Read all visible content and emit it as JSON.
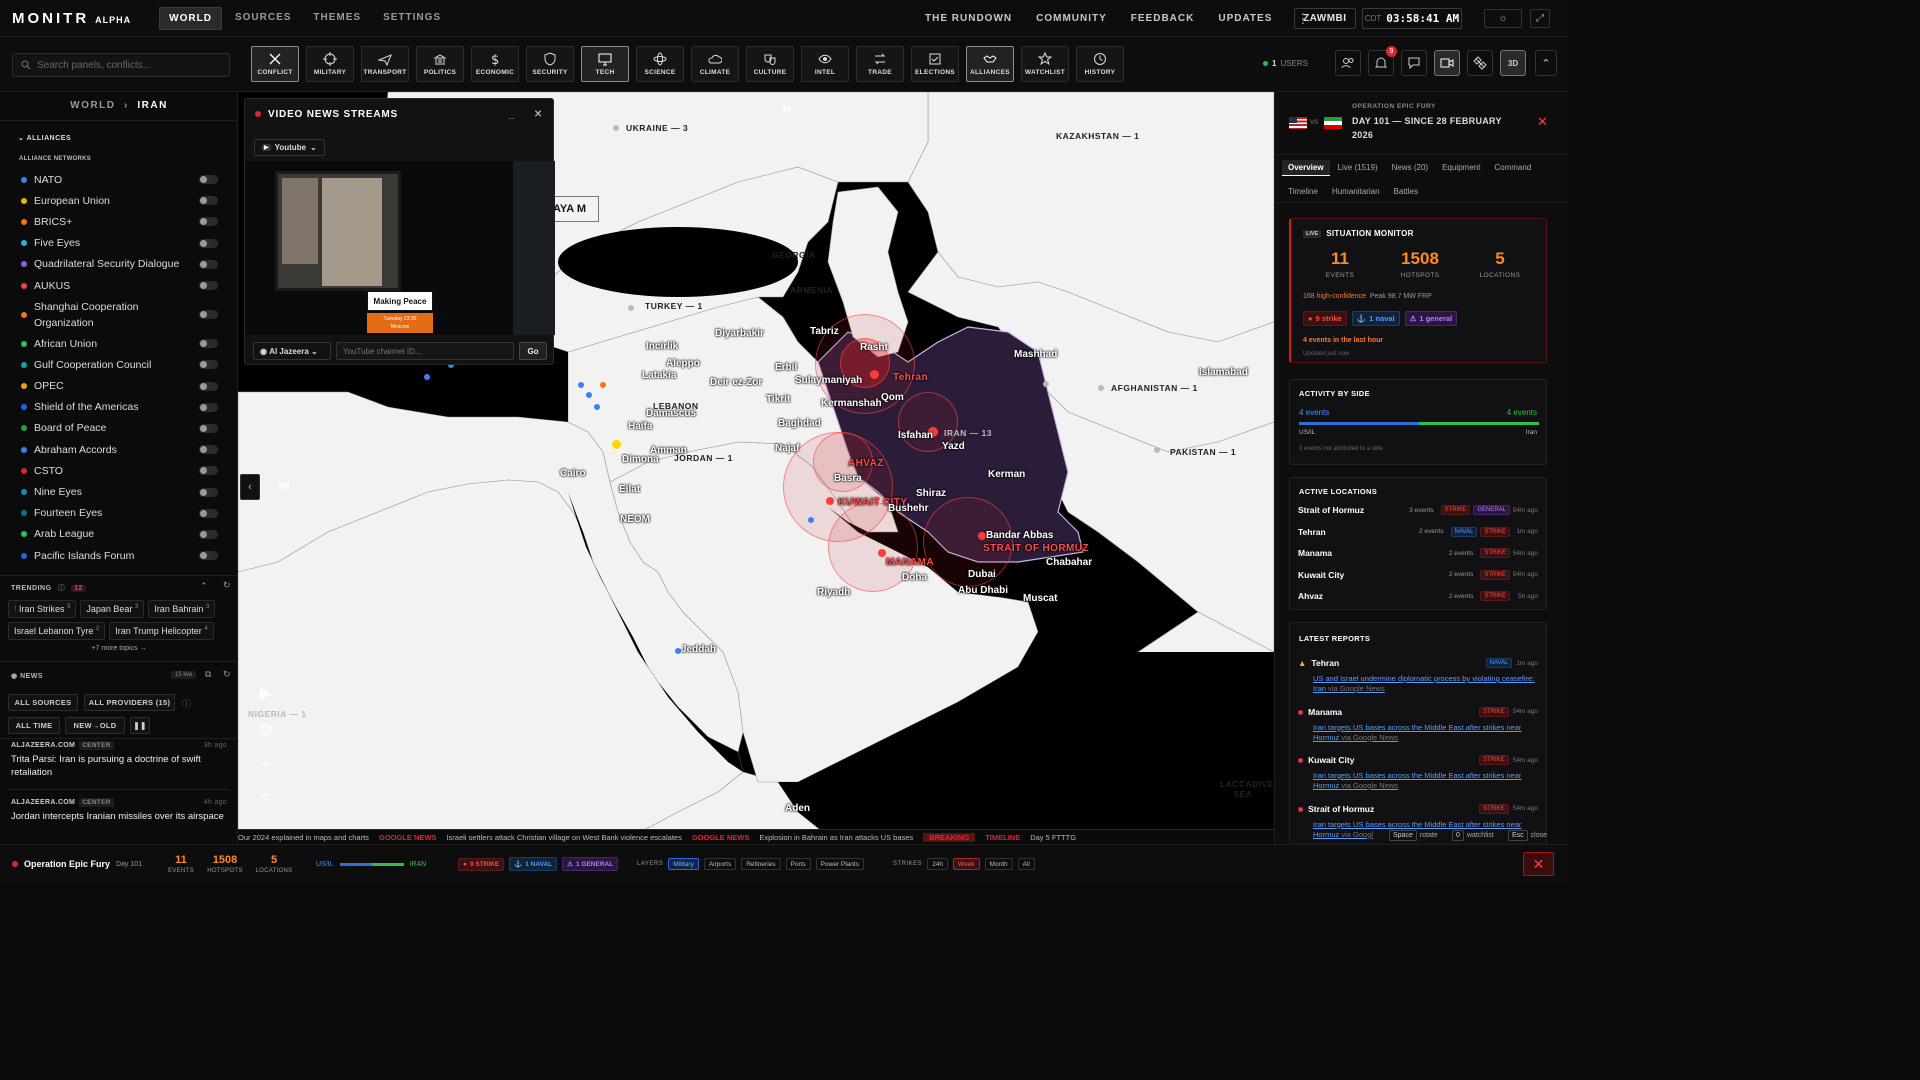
{
  "app": {
    "logo": "MONITR",
    "logo_sub": "ALPHA"
  },
  "nav": {
    "tabs": [
      "WORLD",
      "SOURCES",
      "THEMES",
      "SETTINGS"
    ]
  },
  "toplinks": [
    "THE RUNDOWN",
    "COMMUNITY",
    "FEEDBACK",
    "UPDATES"
  ],
  "user": "ZAWMBI",
  "clock": {
    "tz": "CDT",
    "time": "03:58:41 AM"
  },
  "search": {
    "placeholder": "Search panels, conflicts..."
  },
  "categories": [
    {
      "label": "CONFLICT",
      "icon": "conflict-icon",
      "active": true
    },
    {
      "label": "MILITARY",
      "icon": "crosshair-icon",
      "active": false
    },
    {
      "label": "TRANSPORT",
      "icon": "plane-icon",
      "active": false
    },
    {
      "label": "POLITICS",
      "icon": "capitol-icon",
      "active": false
    },
    {
      "label": "ECONOMIC",
      "icon": "dollar-icon",
      "active": false
    },
    {
      "label": "SECURITY",
      "icon": "shield-icon",
      "active": false
    },
    {
      "label": "TECH",
      "icon": "monitor-icon",
      "active": true
    },
    {
      "label": "SCIENCE",
      "icon": "atom-icon",
      "active": false
    },
    {
      "label": "CLIMATE",
      "icon": "cloud-icon",
      "active": false
    },
    {
      "label": "CULTURE",
      "icon": "masks-icon",
      "active": false
    },
    {
      "label": "INTEL",
      "icon": "eye-icon",
      "active": false
    },
    {
      "label": "TRADE",
      "icon": "exchange-icon",
      "active": false
    },
    {
      "label": "ELECTIONS",
      "icon": "ballot-icon",
      "active": false
    },
    {
      "label": "ALLIANCES",
      "icon": "handshake-icon",
      "active": true
    },
    {
      "label": "WATCHLIST",
      "icon": "star-icon",
      "active": false
    },
    {
      "label": "HISTORY",
      "icon": "clock-icon",
      "active": false
    }
  ],
  "users": {
    "count": "1",
    "label": "USERS"
  },
  "notifications": {
    "count": "9"
  },
  "view_3d": "3D",
  "breadcrumb": {
    "root": "WORLD",
    "current": "IRAN"
  },
  "alliances": {
    "title": "ALLIANCES",
    "subtitle": "ALLIANCE NETWORKS",
    "items": [
      {
        "name": "NATO",
        "color": "#3b82f6"
      },
      {
        "name": "European Union",
        "color": "#eab308"
      },
      {
        "name": "BRICS+",
        "color": "#f97316"
      },
      {
        "name": "Five Eyes",
        "color": "#22b8cf"
      },
      {
        "name": "Quadrilateral Security Dialogue",
        "color": "#8b5cf6"
      },
      {
        "name": "AUKUS",
        "color": "#ef4444"
      },
      {
        "name": "Shanghai Cooperation Organization",
        "color": "#f97316"
      },
      {
        "name": "African Union",
        "color": "#22c55e"
      },
      {
        "name": "Gulf Cooperation Council",
        "color": "#0ea5a4"
      },
      {
        "name": "OPEC",
        "color": "#f59e0b"
      },
      {
        "name": "Shield of the Americas",
        "color": "#2563eb"
      },
      {
        "name": "Board of Peace",
        "color": "#16a34a"
      },
      {
        "name": "Abraham Accords",
        "color": "#3b82f6"
      },
      {
        "name": "CSTO",
        "color": "#dc2626"
      },
      {
        "name": "Nine Eyes",
        "color": "#0891b2"
      },
      {
        "name": "Fourteen Eyes",
        "color": "#0e7490"
      },
      {
        "name": "Arab League",
        "color": "#22c55e"
      },
      {
        "name": "Pacific Islands Forum",
        "color": "#2563eb"
      }
    ]
  },
  "trending": {
    "title": "TRENDING",
    "count": "12",
    "chips": [
      {
        "label": "Iran Strikes",
        "n": "5"
      },
      {
        "label": "Japan Bear",
        "n": "3"
      },
      {
        "label": "Iran Bahrain",
        "n": "3"
      },
      {
        "label": "Israel Lebanon Tyre",
        "n": "2"
      },
      {
        "label": "Iran Trump Helicopter",
        "n": "4"
      }
    ],
    "more": "+7 more topics →"
  },
  "news": {
    "title": "NEWS",
    "live_badge": "15 live",
    "filters": [
      "ALL SOURCES",
      "ALL PROVIDERS (15)",
      "ALL TIME",
      "NEW→OLD"
    ],
    "items": [
      {
        "source": "ALJAZEERA.COM",
        "bias": "CENTER",
        "ago": "3h ago",
        "title": "Trita Parsi: Iran is pursuing a doctrine of swift retaliation"
      },
      {
        "source": "ALJAZEERA.COM",
        "bias": "CENTER",
        "ago": "4h ago",
        "title": "Jordan intercepts Iranian missiles over its airspace"
      }
    ]
  },
  "video": {
    "title": "VIDEO NEWS STREAMS",
    "provider": "Youtube",
    "caption": "Making Peace",
    "caption_sub": "Tuesday 23:30",
    "caption_sub2": "Moscow",
    "channel": "Al Jazeera",
    "input_placeholder": "YouTube channel ID...",
    "go": "Go",
    "overlay_text": "AYA M"
  },
  "map": {
    "compass": {
      "n": "N",
      "w": "W"
    },
    "labels": [
      {
        "text": "Tehran",
        "kind": "red"
      },
      {
        "text": "KUWAIT CITY",
        "kind": "red"
      },
      {
        "text": "MANAMA",
        "kind": "red"
      },
      {
        "text": "STRAIT OF HORMUZ",
        "kind": "red"
      },
      {
        "text": "AHVAZ",
        "kind": "red"
      },
      {
        "text": "Rasht",
        "kind": "city"
      },
      {
        "text": "Mashhad",
        "kind": "city"
      },
      {
        "text": "Qom",
        "kind": "city"
      },
      {
        "text": "Isfahan",
        "kind": "city"
      },
      {
        "text": "Yazd",
        "kind": "city"
      },
      {
        "text": "Kerman",
        "kind": "city"
      },
      {
        "text": "Shiraz",
        "kind": "city"
      },
      {
        "text": "Bushehr",
        "kind": "city"
      },
      {
        "text": "Bandar Abbas",
        "kind": "city"
      },
      {
        "text": "Chabahar",
        "kind": "city"
      },
      {
        "text": "Basra",
        "kind": "city"
      },
      {
        "text": "Najaf",
        "kind": "city"
      },
      {
        "text": "Baghdad",
        "kind": "city"
      },
      {
        "text": "Sulaymaniyah",
        "kind": "city"
      },
      {
        "text": "Erbil",
        "kind": "city"
      },
      {
        "text": "Kermanshah",
        "kind": "city"
      },
      {
        "text": "Tabriz",
        "kind": "city"
      },
      {
        "text": "Diyarbakir",
        "kind": "city"
      },
      {
        "text": "Incirlik",
        "kind": "city"
      },
      {
        "text": "Aleppo",
        "kind": "city"
      },
      {
        "text": "Latakia",
        "kind": "city"
      },
      {
        "text": "Deir ez-Zor",
        "kind": "city"
      },
      {
        "text": "Damascus",
        "kind": "city"
      },
      {
        "text": "Haifa",
        "kind": "city"
      },
      {
        "text": "Dimona",
        "kind": "city"
      },
      {
        "text": "Cairo",
        "kind": "city"
      },
      {
        "text": "Eilat",
        "kind": "city"
      },
      {
        "text": "NEOM",
        "kind": "city"
      },
      {
        "text": "Riyadh",
        "kind": "city"
      },
      {
        "text": "Jeddah",
        "kind": "city"
      },
      {
        "text": "Doha",
        "kind": "city"
      },
      {
        "text": "Dubai",
        "kind": "city"
      },
      {
        "text": "Abu Dhabi",
        "kind": "city"
      },
      {
        "text": "Muscat",
        "kind": "city"
      },
      {
        "text": "Aden",
        "kind": "city"
      },
      {
        "text": "Islamabad",
        "kind": "city"
      },
      {
        "text": "Tikrit",
        "kind": "city"
      },
      {
        "text": "Amman",
        "kind": "city"
      },
      {
        "text": "KAZAKHSTAN",
        "kind": "country"
      },
      {
        "text": "AFGHANISTAN",
        "kind": "country"
      },
      {
        "text": "PAKISTAN",
        "kind": "country"
      },
      {
        "text": "TURKEY",
        "kind": "country"
      },
      {
        "text": "UKRAINE",
        "kind": "country"
      },
      {
        "text": "GEORGIA",
        "kind": "country"
      },
      {
        "text": "ARMENIA",
        "kind": "country"
      },
      {
        "text": "LEBANON",
        "kind": "country"
      },
      {
        "text": "JORDAN",
        "kind": "country"
      },
      {
        "text": "IRAN",
        "kind": "country"
      },
      {
        "text": "NIGERIA",
        "kind": "country"
      },
      {
        "text": "LACCADIVE SEA",
        "kind": "country"
      }
    ],
    "counts": {
      "kazakhstan": "1",
      "afghanistan": "1",
      "pakistan": "1",
      "turkey": "1",
      "ukraine": "3",
      "iran": "13",
      "jordan": "1",
      "nigeria": "1"
    }
  },
  "ticker": [
    {
      "src": "",
      "text": "Our 2024 explained in maps and charts"
    },
    {
      "src": "GOOGLE NEWS",
      "text": "Israeli settlers attack Christian village on West Bank violence escalates"
    },
    {
      "src": "GOOGLE NEWS",
      "text": "Explosion in Bahrain as Iran attacks US bases"
    },
    {
      "src": "BREAKING",
      "text": ""
    },
    {
      "src": "TIMELINE",
      "text": "Day 5 FTTTG"
    }
  ],
  "operation": {
    "label": "OPERATION EPIC FURY",
    "vs": "VS",
    "day": "DAY 101 — SINCE 28 FEBRUARY 2026",
    "tabs": [
      "Overview",
      "Live (1519)",
      "News (20)",
      "Equipment",
      "Command",
      "Timeline",
      "Humanitarian",
      "Battles"
    ],
    "situation": {
      "live": "LIVE",
      "title": "SITUATION MONITOR",
      "events": "11",
      "events_label": "EVENTS",
      "hotspots": "1508",
      "hotspots_label": "HOTSPOTS",
      "locations": "5",
      "locations_label": "LOCATIONS",
      "confidence": "168 high-confidence",
      "peak": "Peak 98.7 MW FRP",
      "tags": [
        "9 strike",
        "1 naval",
        "1 general"
      ],
      "last_hour": "4 events in the last hour",
      "updated": "Updated just now"
    },
    "activity": {
      "title": "ACTIVITY BY SIDE",
      "left_events": "4 events",
      "right_events": "4 events",
      "left_side": "US/IL",
      "right_side": "Iran",
      "left_share": 0.5,
      "note": "3 events not attributed to a side"
    },
    "active_locations": {
      "title": "ACTIVE LOCATIONS",
      "rows": [
        {
          "name": "Strait of Hormuz",
          "events": "3 events",
          "tags": [
            "STRIKE",
            "GENERAL"
          ],
          "ago": "54m ago"
        },
        {
          "name": "Tehran",
          "events": "2 events",
          "tags": [
            "NAVAL",
            "STRIKE"
          ],
          "ago": "1m ago"
        },
        {
          "name": "Manama",
          "events": "2 events",
          "tags": [
            "STRIKE"
          ],
          "ago": "54m ago"
        },
        {
          "name": "Kuwait City",
          "events": "2 events",
          "tags": [
            "STRIKE"
          ],
          "ago": "54m ago"
        },
        {
          "name": "Ahvaz",
          "events": "2 events",
          "tags": [
            "STRIKE"
          ],
          "ago": "5h ago"
        }
      ]
    },
    "reports": {
      "title": "LATEST REPORTS",
      "items": [
        {
          "place": "Tehran",
          "tag": "NAVAL",
          "ago": "1m ago",
          "text": "US and Israel undermine diplomatic process by violating ceasefire: Iran",
          "via": "via Google News"
        },
        {
          "place": "Manama",
          "tag": "STRIKE",
          "ago": "54m ago",
          "text": "Iran targets US bases across the Middle East after strikes near Hormuz",
          "via": "via Google News"
        },
        {
          "place": "Kuwait City",
          "tag": "STRIKE",
          "ago": "54m ago",
          "text": "Iran targets US bases across the Middle East after strikes near Hormuz",
          "via": "via Google News"
        },
        {
          "place": "Strait of Hormuz",
          "tag": "STRIKE",
          "ago": "54m ago",
          "text": "Iran targets US bases across the Middle East after strikes near Hormuz",
          "via": "via Googl"
        }
      ]
    }
  },
  "shortcuts": [
    {
      "key": "Space",
      "label": "rotate"
    },
    {
      "key": "0",
      "label": "watchlist"
    },
    {
      "key": "Esc",
      "label": "close"
    }
  ],
  "bottom": {
    "op_name": "Operation Epic Fury",
    "day": "Day 101",
    "events": "11",
    "events_label": "EVENTS",
    "hotspots": "1508",
    "hotspots_label": "HOTSPOTS",
    "locations": "5",
    "locations_label": "LOCATIONS",
    "left_side": "US/IL",
    "right_side": "IRAN",
    "tags": [
      "9 STRIKE",
      "1 NAVAL",
      "1 GENERAL"
    ],
    "layers_label": "LAYERS",
    "layers": [
      {
        "label": "Military",
        "on": true
      },
      {
        "label": "Airports",
        "on": false
      },
      {
        "label": "Refineries",
        "on": false
      },
      {
        "label": "Ports",
        "on": false
      },
      {
        "label": "Power Plants",
        "on": false
      }
    ],
    "strikes_label": "STRIKES",
    "strikes": [
      {
        "label": "24h",
        "on": false
      },
      {
        "label": "Week",
        "on": true
      },
      {
        "label": "Month",
        "on": false
      },
      {
        "label": "All",
        "on": false
      }
    ]
  }
}
